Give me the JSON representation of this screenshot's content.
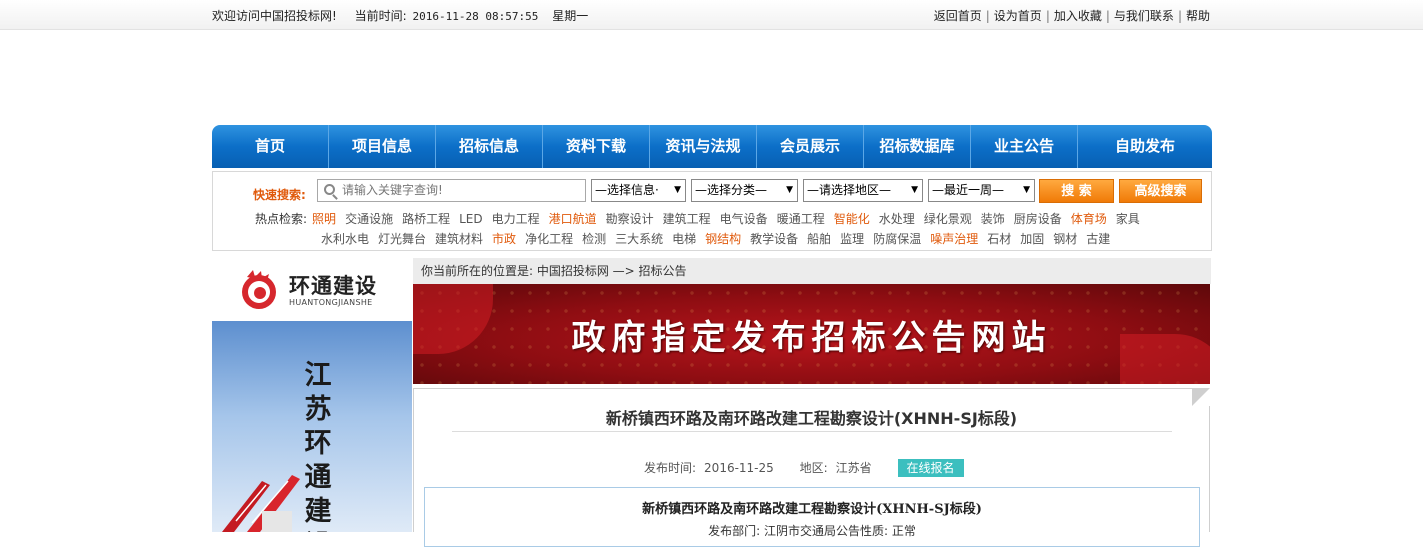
{
  "topbar": {
    "welcome": "欢迎访问中国招投标网!",
    "time_label": "当前时间:",
    "time_value": "2016-11-28 08:57:55",
    "weekday": "星期一",
    "links": [
      "返回首页",
      "设为首页",
      "加入收藏",
      "与我们联系",
      "帮助"
    ]
  },
  "nav": {
    "items": [
      "首页",
      "项目信息",
      "招标信息",
      "资料下载",
      "资讯与法规",
      "会员展示",
      "招标数据库",
      "业主公告",
      "自助发布"
    ]
  },
  "search": {
    "label": "快速搜索:",
    "placeholder": "请输入关键字查询!",
    "select_info": "—选择信息·",
    "select_category": "—选择分类—",
    "select_region": "—请选择地区—",
    "select_period": "—最近一周—",
    "search_button": "搜 索",
    "advanced_button": "高级搜索",
    "hot_label": "热点检索:",
    "hot_row1": [
      {
        "t": "照明",
        "hl": true
      },
      {
        "t": "交通设施",
        "hl": false
      },
      {
        "t": "路桥工程",
        "hl": false
      },
      {
        "t": "LED",
        "hl": false
      },
      {
        "t": "电力工程",
        "hl": false
      },
      {
        "t": "港口航道",
        "hl": true
      },
      {
        "t": "勘察设计",
        "hl": false
      },
      {
        "t": "建筑工程",
        "hl": false
      },
      {
        "t": "电气设备",
        "hl": false
      },
      {
        "t": "暖通工程",
        "hl": false
      },
      {
        "t": "智能化",
        "hl": true
      },
      {
        "t": "水处理",
        "hl": false
      },
      {
        "t": "绿化景观",
        "hl": false
      },
      {
        "t": "装饰",
        "hl": false
      },
      {
        "t": "厨房设备",
        "hl": false
      },
      {
        "t": "体育场",
        "hl": true
      },
      {
        "t": "家具",
        "hl": false
      }
    ],
    "hot_row2": [
      {
        "t": "水利水电",
        "hl": false
      },
      {
        "t": "灯光舞台",
        "hl": false
      },
      {
        "t": "建筑材料",
        "hl": false
      },
      {
        "t": "市政",
        "hl": true
      },
      {
        "t": "净化工程",
        "hl": false
      },
      {
        "t": "检测",
        "hl": false
      },
      {
        "t": "三大系统",
        "hl": false
      },
      {
        "t": "电梯",
        "hl": false
      },
      {
        "t": "钢结构",
        "hl": true
      },
      {
        "t": "教学设备",
        "hl": false
      },
      {
        "t": "船舶",
        "hl": false
      },
      {
        "t": "监理",
        "hl": false
      },
      {
        "t": "防腐保温",
        "hl": false
      },
      {
        "t": "噪声治理",
        "hl": true
      },
      {
        "t": "石材",
        "hl": false
      },
      {
        "t": "加固",
        "hl": false
      },
      {
        "t": "钢材",
        "hl": false
      },
      {
        "t": "古建",
        "hl": false
      }
    ]
  },
  "sidebar": {
    "logo_cn": "环通建设",
    "logo_en": "HUANTONGJIANSHE",
    "ad_text": [
      "江",
      "苏",
      "环",
      "通",
      "建",
      "设"
    ]
  },
  "breadcrumb": "你当前所在的位置是: 中国招投标网 —> 招标公告",
  "banner_title": "政府指定发布招标公告网站",
  "article": {
    "title": "新桥镇西环路及南环路改建工程勘察设计(XHNH-SJ标段)",
    "date_label": "发布时间:",
    "date": "2016-11-25",
    "region_label": "地区:",
    "region": "江苏省",
    "register_button": "在线报名",
    "inner_title": "新桥镇西环路及南环路改建工程勘察设计(XHNH-SJ标段)",
    "inner_sub": "发布部门: 江阴市交通局公告性质: 正常"
  },
  "colors": {
    "nav_blue": "#0c6fc8",
    "accent_orange": "#e05a0c",
    "banner_red": "#a01218",
    "register_teal": "#3cbfbf"
  }
}
